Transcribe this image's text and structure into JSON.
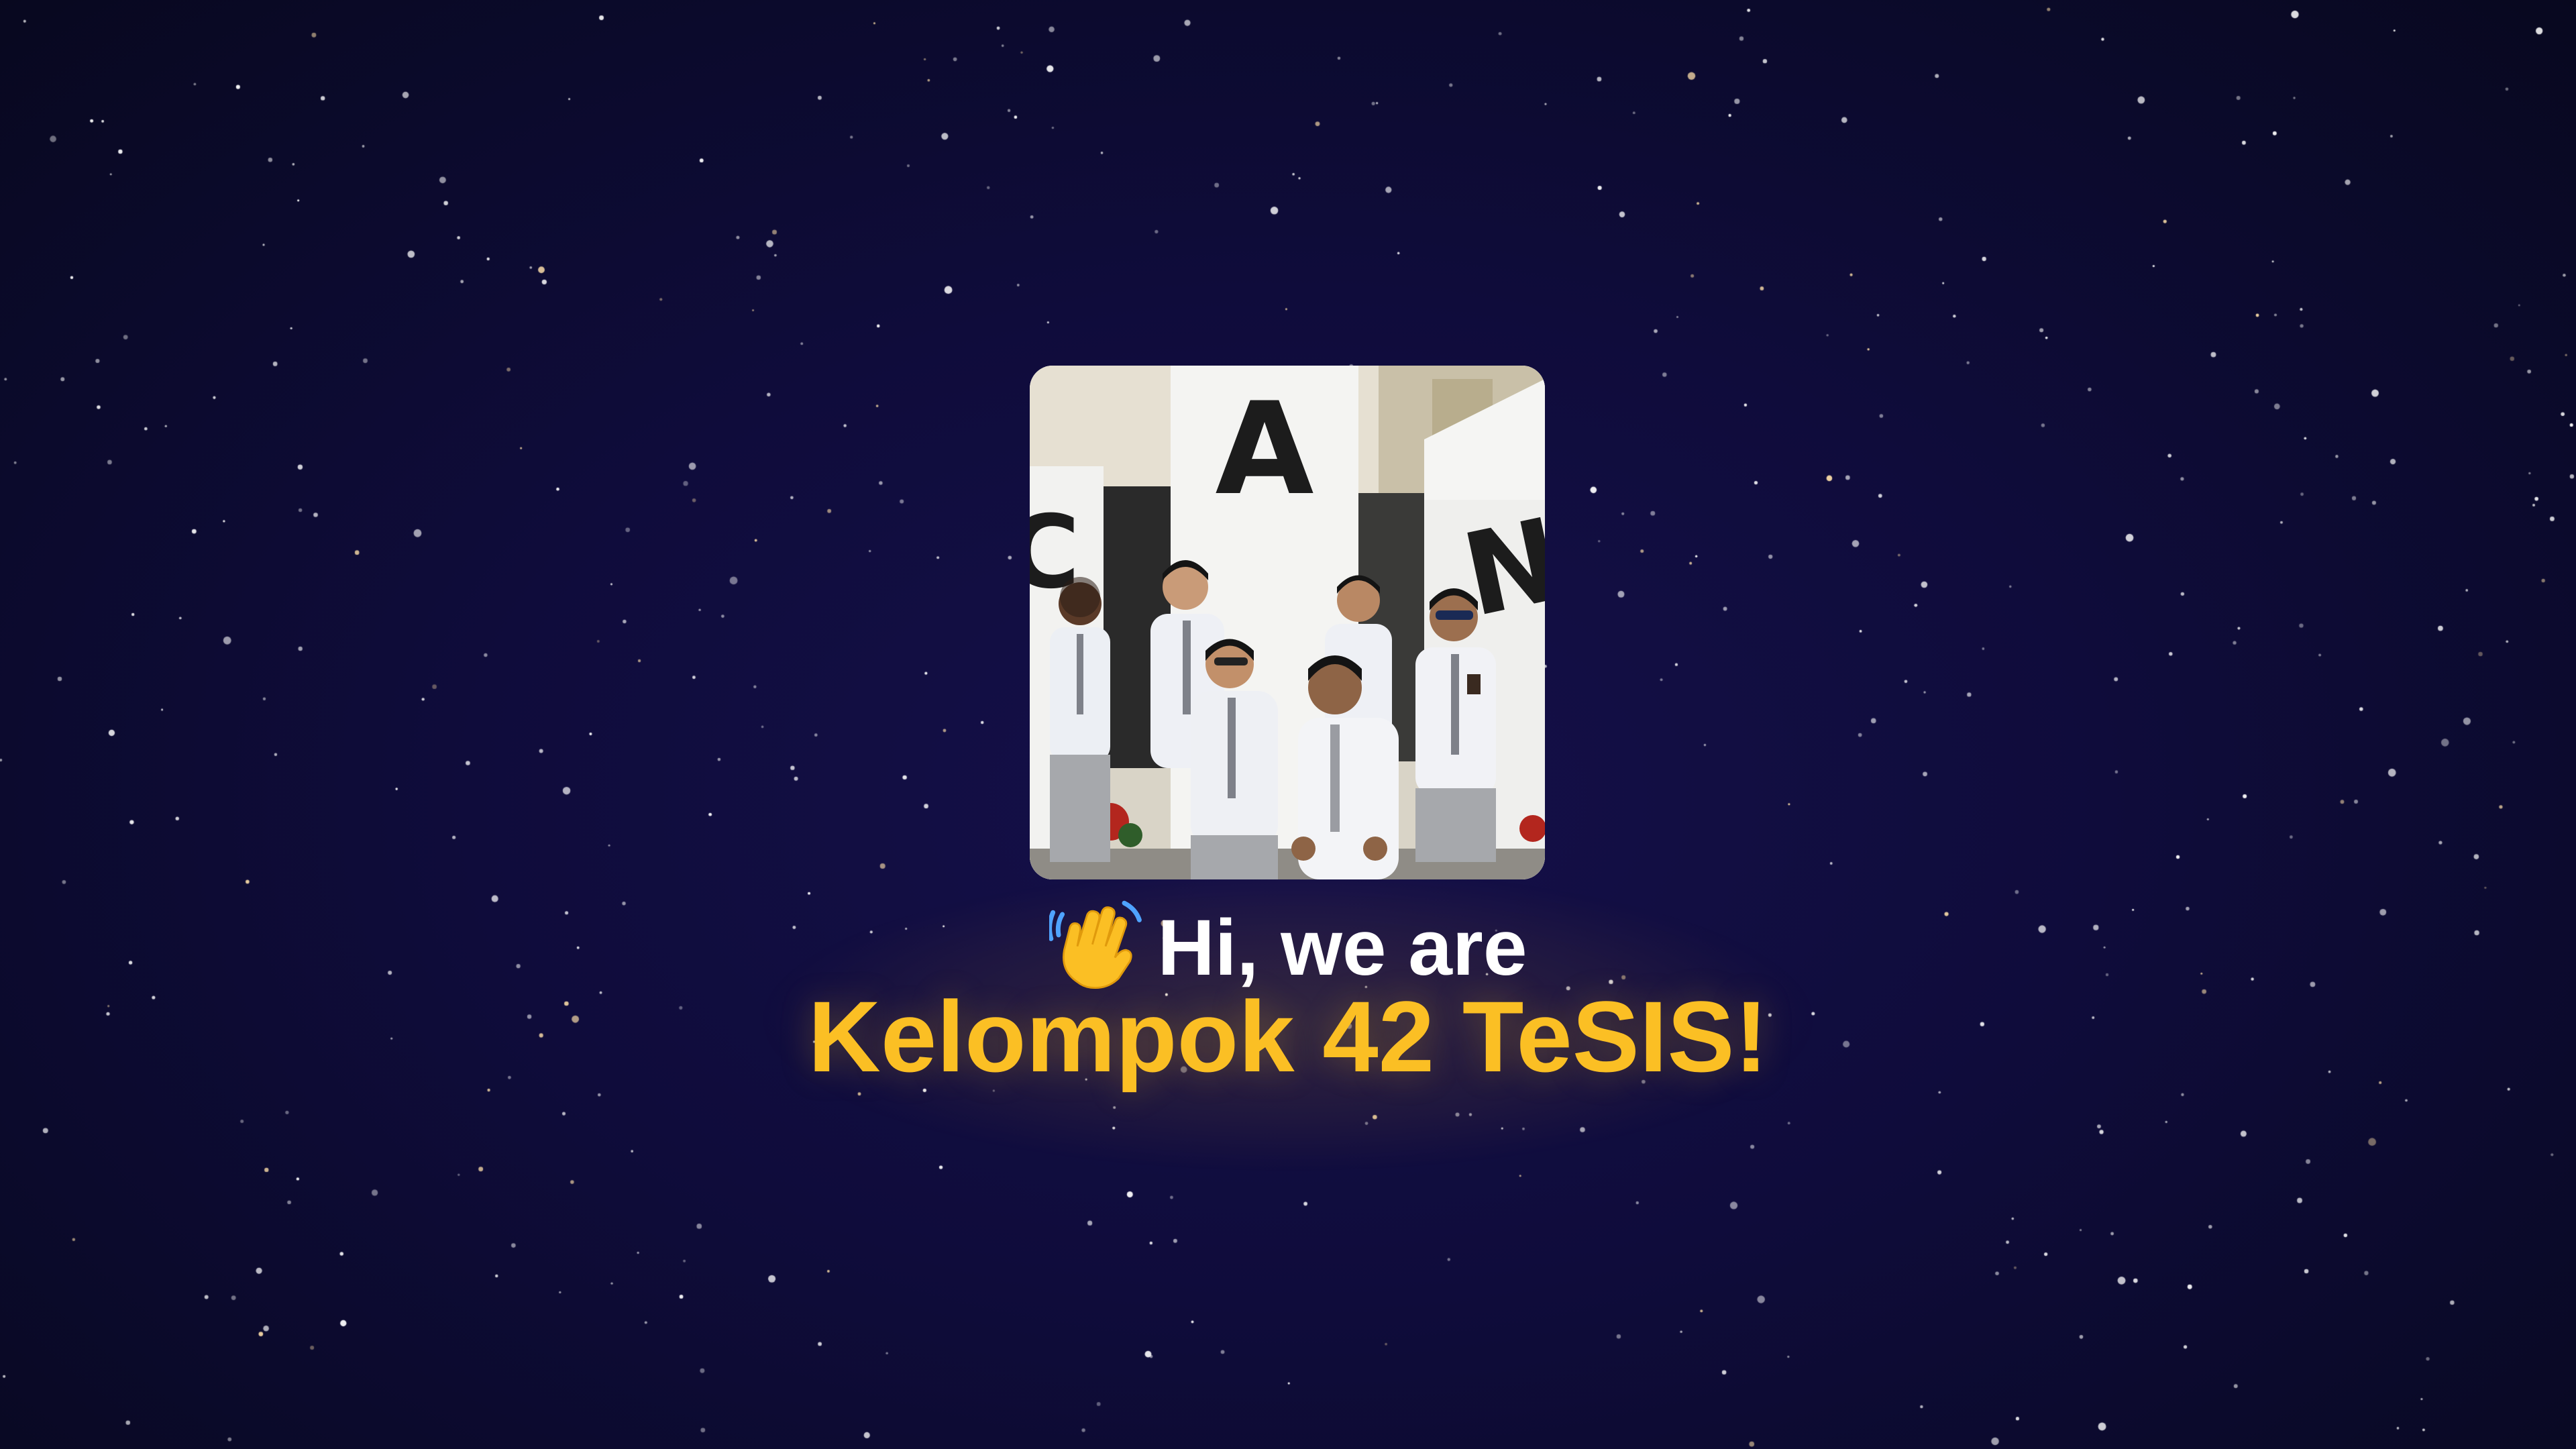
{
  "hero": {
    "greeting": "Hi, we are",
    "group_name": "Kelompok 42 TeSIS!",
    "wave_emoji": "waving-hand-icon"
  },
  "photo": {
    "building_letters": [
      "A",
      "C",
      "N"
    ]
  },
  "colors": {
    "background": "#0f0c3b",
    "accent": "#fbbf24",
    "text": "#ffffff"
  }
}
